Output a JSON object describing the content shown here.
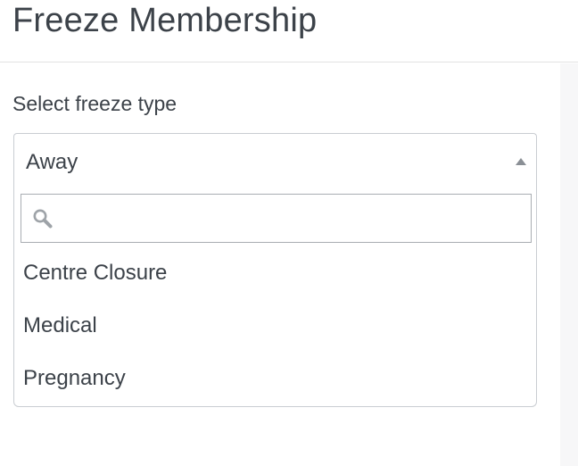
{
  "header": {
    "title": "Freeze Membership"
  },
  "form": {
    "label": "Select freeze type",
    "select": {
      "selected": "Away",
      "search_placeholder": "",
      "search_value": "",
      "options": [
        {
          "label": "Centre Closure"
        },
        {
          "label": "Medical"
        },
        {
          "label": "Pregnancy"
        }
      ]
    }
  },
  "icons": {
    "search": "search-icon",
    "caret": "caret-up-icon"
  },
  "colors": {
    "text": "#3c4249",
    "border": "#c9cdd2",
    "search_border": "#a9adb2",
    "icon": "#8a8f95",
    "side_panel": "#f7f7f8"
  }
}
